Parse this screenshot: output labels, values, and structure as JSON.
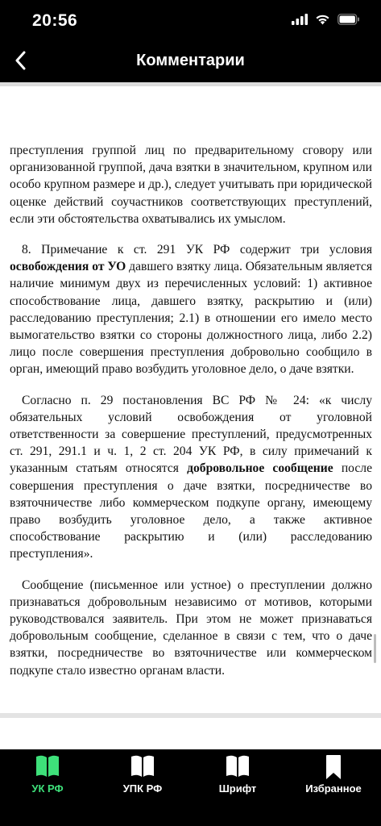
{
  "status_bar": {
    "time": "20:56"
  },
  "nav": {
    "title": "Комментарии"
  },
  "content": {
    "p1": "преступления группой лиц по предварительному сговору или организованной группой, дача взятки в значительном, крупном или особо крупном размере и др.), следует учитывать при юридической оценке действий соучастников соответствующих преступлений, если эти обстоятельства охватывались их умыслом.",
    "p2_a": "8. Примечание к ст. 291 УК РФ содержит три условия ",
    "p2_bold": "освобождения от УО",
    "p2_b": " давшего взятку лица. Обязательным является наличие минимум двух из перечисленных условий: 1) активное способствование лица, давшего взятку, раскрытию и (или) расследованию преступления; 2.1) в отношении его имело место вымогательство взятки со стороны должностного лица, либо 2.2) лицо после совершения преступления добровольно сообщило в орган, имеющий право возбудить уголовное дело, о даче взятки.",
    "p3_a": "Согласно п. 29 постановления ВС РФ № 24: «к числу обязательных условий освобождения от уголовной ответственности за совершение преступлений, предусмотренных ст. 291, 291.1 и ч. 1, 2 ст. 204 УК РФ, в силу примечаний к указанным статьям относятся ",
    "p3_bold": "добровольное сообщение",
    "p3_b": " после совершения преступления о даче взятки, посредничестве во взяточничестве либо коммерческом подкупе органу, имеющему право возбудить уголовное дело, а также активное способствование раскрытию и (или) расследованию преступления».",
    "p4": "Сообщение (письменное или устное) о преступлении должно признаваться добровольным независимо от мотивов, которыми руководствовался заявитель. При этом не может признаваться добровольным сообщение, сделанное в связи с тем, что о даче взятки, посредничестве во взяточничестве или коммерческом подкупе стало известно органам власти."
  },
  "tabs": [
    {
      "label": "УК РФ",
      "icon": "open-book-icon",
      "active": true
    },
    {
      "label": "УПК РФ",
      "icon": "open-book-icon",
      "active": false
    },
    {
      "label": "Шрифт",
      "icon": "open-book-icon",
      "active": false
    },
    {
      "label": "Избранное",
      "icon": "bookmark-icon",
      "active": false
    }
  ],
  "colors": {
    "accent": "#3ee07a",
    "bar": "#000000",
    "text": "#111111"
  }
}
